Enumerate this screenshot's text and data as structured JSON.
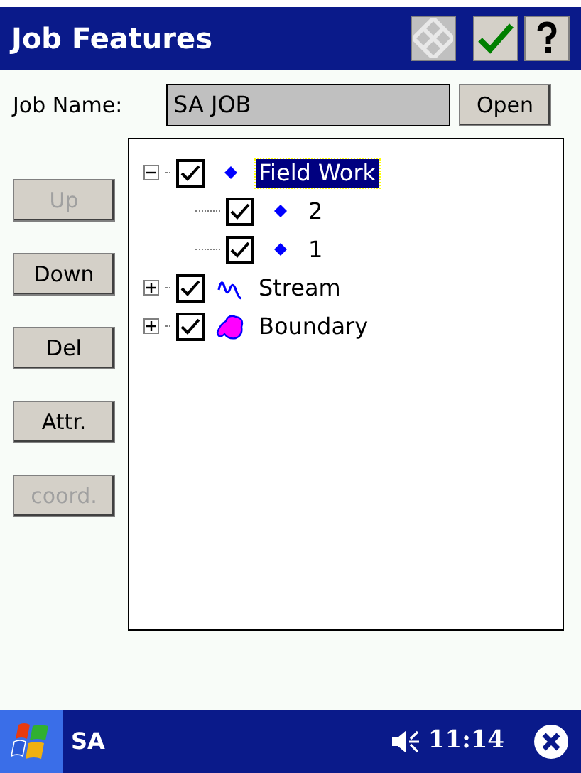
{
  "window": {
    "title": "Job Features"
  },
  "job_name": {
    "label": "Job Name:",
    "value": "SA JOB",
    "button": "Open"
  },
  "side_buttons": [
    {
      "label": "Up",
      "disabled": true
    },
    {
      "label": "Down",
      "disabled": false
    },
    {
      "label": "Del",
      "disabled": false
    },
    {
      "label": "Attr.",
      "disabled": false
    },
    {
      "label": "coord.",
      "disabled": true
    }
  ],
  "tree": [
    {
      "label": "Field Work",
      "kind": "point",
      "checked": true,
      "selected": true,
      "expanded": true,
      "children": [
        {
          "label": "2",
          "kind": "point",
          "checked": true,
          "selected": false
        },
        {
          "label": "1",
          "kind": "point",
          "checked": true,
          "selected": false
        }
      ]
    },
    {
      "label": "Stream",
      "kind": "line",
      "checked": true,
      "selected": false,
      "expanded": false
    },
    {
      "label": "Boundary",
      "kind": "area",
      "checked": true,
      "selected": false,
      "expanded": false
    }
  ],
  "taskbar": {
    "app": "SA",
    "time": "11:14"
  }
}
